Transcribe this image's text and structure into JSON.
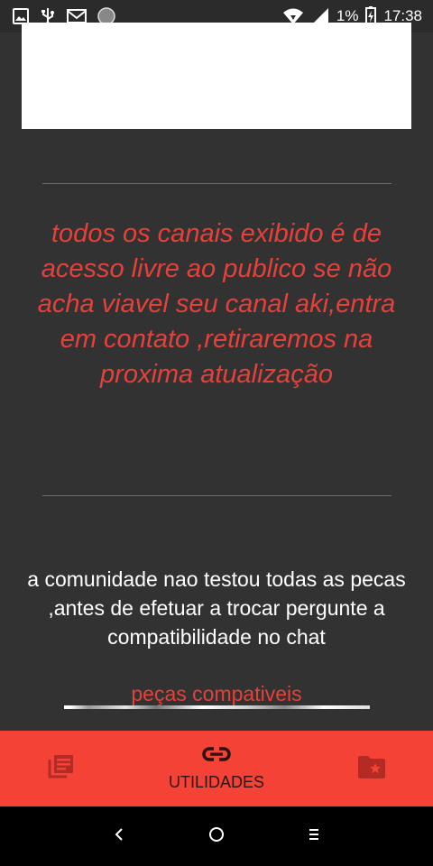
{
  "status_bar": {
    "battery_percent": "1%",
    "time": "17:38",
    "icons": [
      "image-icon",
      "usb-icon",
      "gmail-icon",
      "circle-icon",
      "wifi-icon",
      "signal-icon",
      "battery-charging-icon"
    ]
  },
  "notice_text": "todos os canais exibido é de acesso livre ao publico se não acha viavel seu canal aki,entra em contato ,retiraremos na proxima atualização",
  "community_text": "a comunidade nao testou todas as pecas ,antes de efetuar a trocar pergunte a compatibilidade no chat",
  "parts_link": "peças compativeis",
  "bottom_nav": {
    "left_icon": "news-icon",
    "center_icon": "link-icon",
    "center_label": "UTILIDADES",
    "right_icon": "folder-star-icon"
  },
  "colors": {
    "background": "#323232",
    "accent": "#e5413a",
    "nav": "#f44336"
  }
}
